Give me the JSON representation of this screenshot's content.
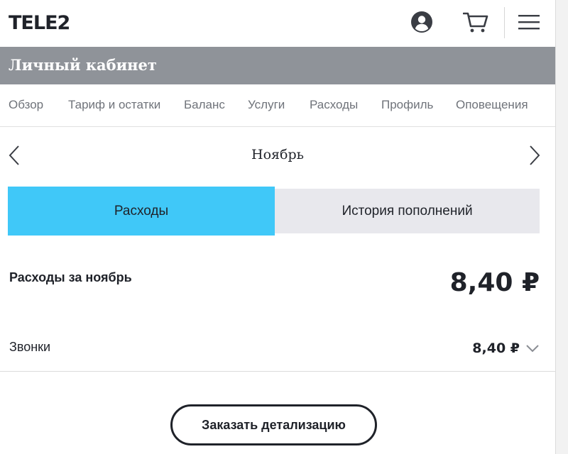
{
  "header": {
    "logo_text": "TELE2",
    "icons": [
      "user-account-icon",
      "cart-icon",
      "hamburger-menu-icon"
    ]
  },
  "titlebar": {
    "title": "Личный кабинет"
  },
  "nav": {
    "items": [
      {
        "label": "Обзор"
      },
      {
        "label": "Тариф и остатки"
      },
      {
        "label": "Баланс"
      },
      {
        "label": "Услуги"
      },
      {
        "label": "Расходы"
      },
      {
        "label": "Профиль"
      },
      {
        "label": "Оповещения"
      }
    ]
  },
  "month": {
    "label": "Ноябрь"
  },
  "tabs": {
    "active": "Расходы",
    "inactive": "История пополнений"
  },
  "summary": {
    "label": "Расходы за ноябрь",
    "amount": "8,40 ₽"
  },
  "calls": {
    "label": "Звонки",
    "amount": "8,40 ₽"
  },
  "actions": {
    "order_label": "Заказать детализацию"
  },
  "colors": {
    "accent_active_tab": "#40c8f8",
    "titlebar_bg": "#8f9399",
    "inactive_tab_bg": "#e8e8ed",
    "text_dark": "#1f2229",
    "nav_text": "#6f737a"
  }
}
